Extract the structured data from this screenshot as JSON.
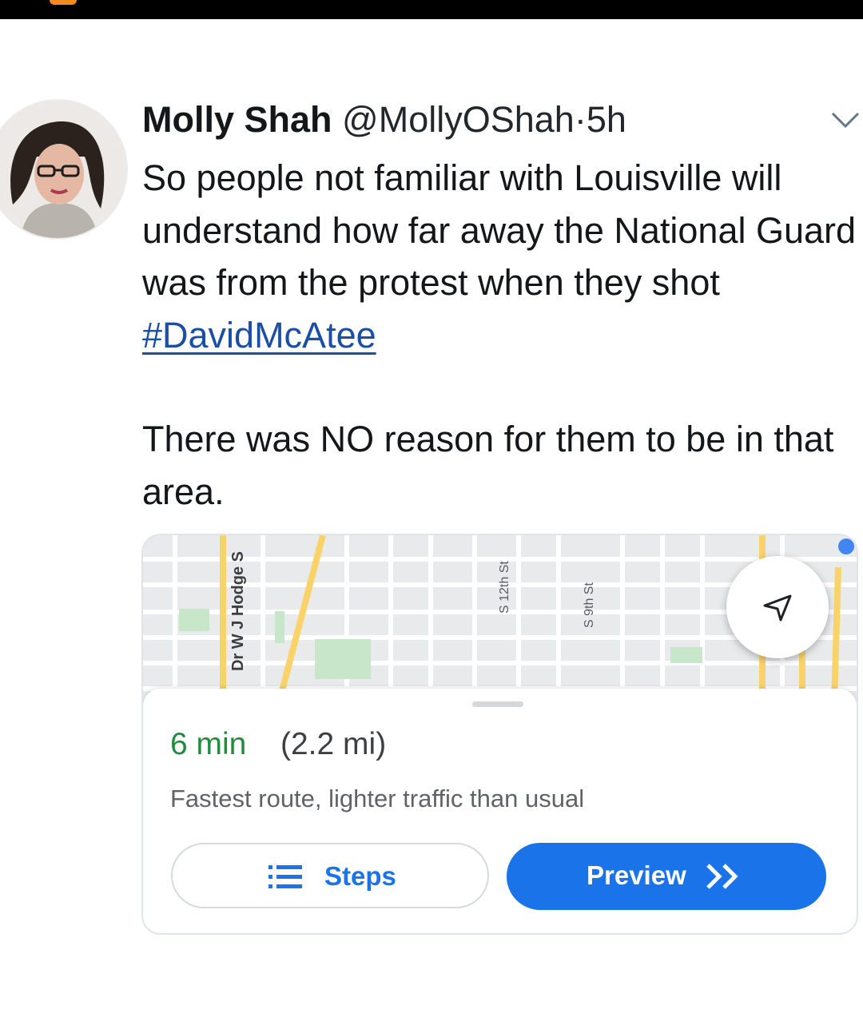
{
  "tweet": {
    "name": "Molly Shah",
    "handle": "@MollyOShah",
    "separator": "·",
    "time": "5h",
    "text_para1": "So people not familiar with Louisville will understand how far away the National Guard was from the protest when they shot ",
    "hashtag": "#DavidMcAtee",
    "text_para2": "There was NO reason for them to be in that area."
  },
  "map": {
    "street_labels": [
      "Dr W J Hodge S",
      "S 12th St",
      "S 9th St"
    ],
    "route_time": "6 min",
    "route_distance": "(2.2 mi)",
    "route_description": "Fastest route, lighter traffic than usual",
    "steps_label": "Steps",
    "preview_label": "Preview"
  },
  "colors": {
    "route_time": "#1e8e3e",
    "primary_blue": "#1a73e8",
    "hashtag": "#1b4fa5"
  },
  "icons": {
    "more": "chevron-down-icon",
    "recenter": "navigation-arrow-icon",
    "steps": "list-icon",
    "preview": "double-chevron-right-icon"
  }
}
